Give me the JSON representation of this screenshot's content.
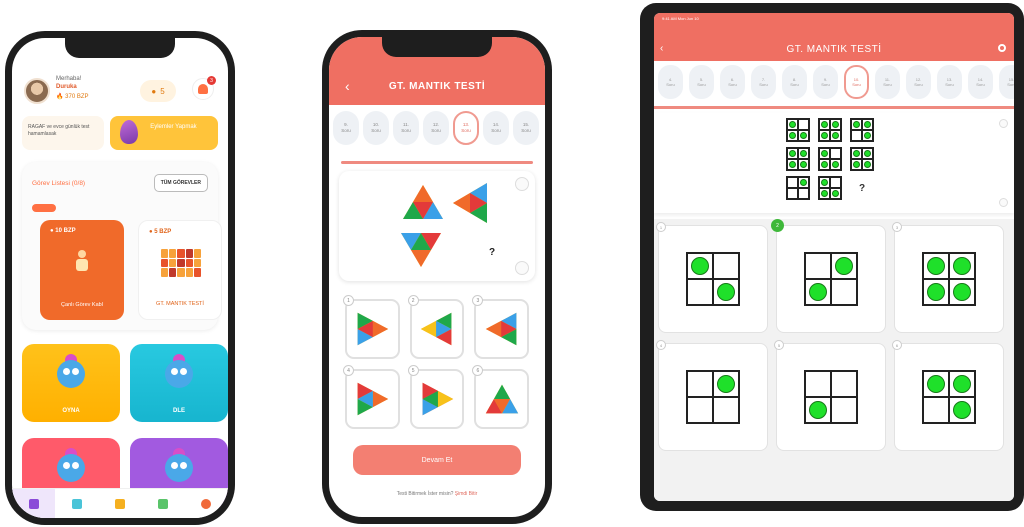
{
  "phone1": {
    "greeting": "Merhaba!",
    "username": "Duruka",
    "points": "370 BZP",
    "coins": "5",
    "notif_count": "3",
    "promo_text": "RAGAF ve evce günlük test hamamlasak",
    "promo_button": "Eylemler Yapmak",
    "task_list_title": "Görev Listesi (0/8)",
    "all_tasks_button": "TÜM GÖREVLER",
    "task_tiles": [
      {
        "points": "10 BZP",
        "caption": "Çanlı Görev Kabl"
      },
      {
        "points": "5 BZP",
        "caption": "GT. MANTIK TESTİ"
      }
    ],
    "games": [
      {
        "label": "OYNA",
        "color": "#ffb000"
      },
      {
        "label": "DLE",
        "color": "#17b5cf"
      },
      {
        "label": "",
        "color": "#ff5a6a"
      },
      {
        "label": "",
        "color": "#a25ae0"
      }
    ]
  },
  "phone2": {
    "title": "GT. MANTIK TESTİ",
    "tabs": [
      {
        "num": "9.",
        "label": "Soru"
      },
      {
        "num": "10.",
        "label": "Soru"
      },
      {
        "num": "11.",
        "label": "Soru"
      },
      {
        "num": "12.",
        "label": "Soru"
      },
      {
        "num": "13.",
        "label": "Soru"
      },
      {
        "num": "14.",
        "label": "Soru"
      },
      {
        "num": "15.",
        "label": "Soru"
      }
    ],
    "active_tab_index": 4,
    "option_numbers": [
      "1",
      "2",
      "3",
      "4",
      "5",
      "6"
    ],
    "continue_button": "Devam Et",
    "footer_text": "Testi Bitirmek İster misin?",
    "footer_link": "Şimdi Bitir"
  },
  "tablet": {
    "status_text": "9:41 AM  Mon Jun 10",
    "title": "GT. MANTIK TESTİ",
    "tabs": [
      {
        "num": "4.",
        "label": "Soru"
      },
      {
        "num": "5.",
        "label": "Soru"
      },
      {
        "num": "6.",
        "label": "Soru"
      },
      {
        "num": "7.",
        "label": "Soru"
      },
      {
        "num": "8.",
        "label": "Soru"
      },
      {
        "num": "9.",
        "label": "Soru"
      },
      {
        "num": "10.",
        "label": "Soru"
      },
      {
        "num": "11.",
        "label": "Soru"
      },
      {
        "num": "12.",
        "label": "Soru"
      },
      {
        "num": "13.",
        "label": "Soru"
      },
      {
        "num": "14.",
        "label": "Soru"
      },
      {
        "num": "15.",
        "label": "Soru"
      }
    ],
    "active_tab_index": 6,
    "question_mark": "?",
    "answer_numbers": [
      "1",
      "2",
      "3",
      "4",
      "5",
      "6"
    ],
    "selected_answer_index": 1
  },
  "colors": {
    "accent": "#ef6f62",
    "green": "#1fe02a",
    "orange": "#f06a2a"
  }
}
